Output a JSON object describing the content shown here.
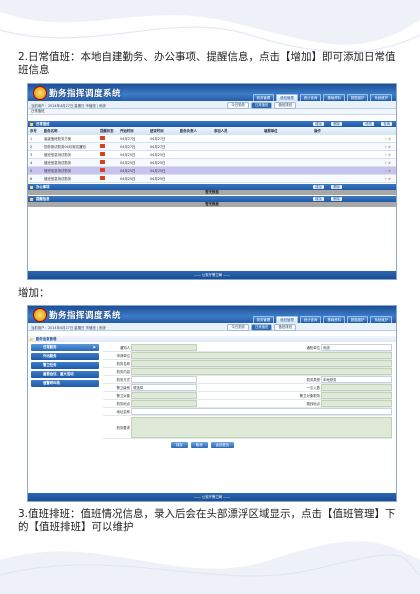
{
  "section1": {
    "text": "2.日常值班：本地自建勤务、办公事项、提醒信息，点击【增加】即可添加日常值班信息"
  },
  "screenshot1": {
    "app_title": "勤务指挥调度系统",
    "nav": [
      "勤务管理",
      "值班管理",
      "统计查询",
      "基础资料",
      "数据维护",
      "系统维护"
    ],
    "active_nav_index": 1,
    "userline": "当前用户：2014年4月27日 星期日 市值班 | 系统",
    "subtabs": [
      "今日勤务",
      "日常值班",
      "值班排班"
    ],
    "active_subtab_index": 1,
    "breadcrumb": "日常值班",
    "section_daily": {
      "title": "日常值班",
      "buttons": [
        "增加",
        "删除",
        "修改",
        "查询"
      ]
    },
    "table": {
      "headers": [
        "序号",
        "勤务名称",
        "提醒状态",
        "开始时间",
        "结束时间",
        "勤务负责人",
        "参加人员",
        "填报单位",
        "操作"
      ],
      "rows": [
        {
          "no": "1",
          "name": "省级值班勤务方案",
          "start": "04月27日",
          "end": "04月27日"
        },
        {
          "no": "2",
          "name": "勤务测试勤务04月测试通知",
          "start": "04月27日",
          "end": "04月27日"
        },
        {
          "no": "3",
          "name": "值班信息测试勤务",
          "start": "04月25日",
          "end": "04月25日"
        },
        {
          "no": "4",
          "name": "值班信息测试勤务",
          "start": "04月25日",
          "end": "04月25日"
        },
        {
          "no": "5",
          "name": "值班信息测试勤务",
          "start": "04月25日",
          "end": "04月25日"
        },
        {
          "no": "6",
          "name": "值班信息测试勤务",
          "start": "04月25日",
          "end": "04月25日"
        }
      ],
      "highlight_row_index": 4,
      "ok_glyph": "✓",
      "del_glyph": "✕"
    },
    "section_office": {
      "title": "办公事项",
      "buttons": [
        "增加",
        "删除"
      ],
      "bar_text": "暂无数据"
    },
    "section_remind": {
      "title": "提醒信息",
      "buttons": [
        "增加",
        "删除"
      ],
      "bar_text": "暂无数据"
    },
    "footer": "—— 公安厅警卫局 ——"
  },
  "add_label": "增加：",
  "screenshot2": {
    "app_title": "勤务指挥调度系统",
    "nav": [
      "勤务管理",
      "值班管理",
      "统计查询",
      "基础资料",
      "数据维护",
      "系统维护"
    ],
    "active_nav_index": 1,
    "userline": "当前用户：2014年4月27日 星期日 市值班 | 系统",
    "subtabs": [
      "今日勤务",
      "日常值班",
      "值班排班"
    ],
    "active_subtab_index": 1,
    "form_title": "勤务信息管理",
    "panel_buttons": [
      "日常勤务",
      "外出勤务",
      "警卫任务",
      "重要会议、重大活动",
      "值警呼叫场"
    ],
    "form_labels": {
      "r1a": "通知人",
      "r1b": "通知单位",
      "r2a": "申请单位",
      "r3a": "勤务名称",
      "r4a": "勤务内容",
      "r5a": "勤务方式",
      "r5b": "勤务类型",
      "r6a": "警卫级别",
      "r6b": "一引入数",
      "r7a": "警卫对象",
      "r7b": "警卫对象职务",
      "r8a": "勤务地点",
      "r8b": "路线地点",
      "r9a": "地址名称",
      "r10a": "勤务要求"
    },
    "form_values": {
      "r1b": "系统",
      "r5b": "本地勤务",
      "r6a": "请选择"
    },
    "actions": [
      "保存",
      "取消",
      "返回首页"
    ],
    "footer": "—— 公安厅警卫局 ——"
  },
  "section3": {
    "text": "3.值班排班：值班情况信息，录入后会在头部漂浮区域显示，点击【值班管理】下的【值班排班】可以维护"
  }
}
